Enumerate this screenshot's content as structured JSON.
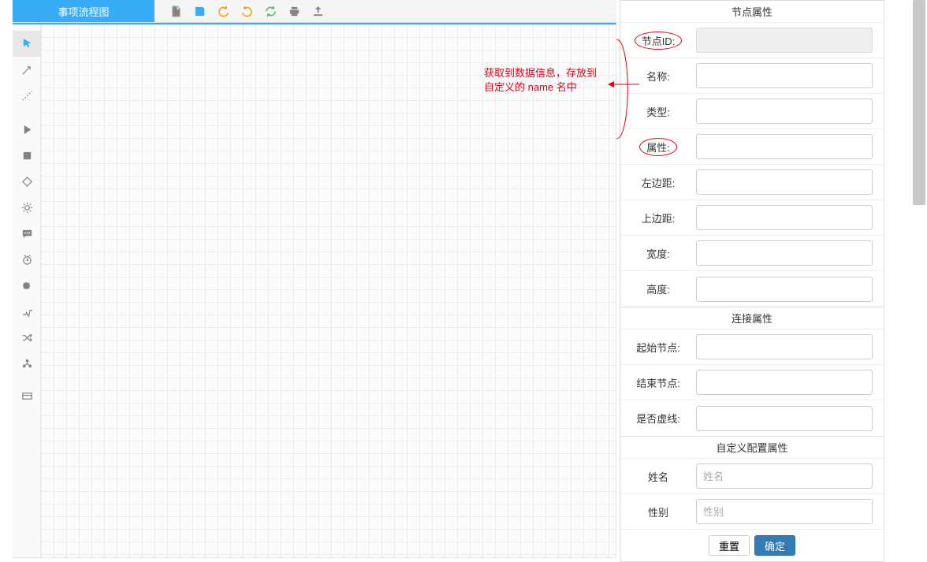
{
  "title": "事项流程图",
  "annotation": {
    "line1": "获取到数据信息，存放到",
    "line2": "自定义的 name 名中"
  },
  "sections": {
    "node": {
      "title": "节点属性",
      "fields": [
        {
          "key": "nodeId",
          "label": "节点ID:",
          "circled": true,
          "readonly": true,
          "value": ""
        },
        {
          "key": "name",
          "label": "名称:",
          "circled": false,
          "readonly": false,
          "value": ""
        },
        {
          "key": "type",
          "label": "类型:",
          "circled": false,
          "readonly": false,
          "value": ""
        },
        {
          "key": "attr",
          "label": "属性:",
          "circled": true,
          "readonly": false,
          "value": ""
        },
        {
          "key": "left",
          "label": "左边距:",
          "circled": false,
          "readonly": false,
          "value": ""
        },
        {
          "key": "top",
          "label": "上边距:",
          "circled": false,
          "readonly": false,
          "value": ""
        },
        {
          "key": "width",
          "label": "宽度:",
          "circled": false,
          "readonly": false,
          "value": ""
        },
        {
          "key": "height",
          "label": "高度:",
          "circled": false,
          "readonly": false,
          "value": ""
        }
      ]
    },
    "conn": {
      "title": "连接属性",
      "fields": [
        {
          "key": "startNode",
          "label": "起始节点:",
          "value": ""
        },
        {
          "key": "endNode",
          "label": "结束节点:",
          "value": ""
        },
        {
          "key": "dashed",
          "label": "是否虚线:",
          "value": ""
        }
      ]
    },
    "custom": {
      "title": "自定义配置属性",
      "fields": [
        {
          "key": "xingming",
          "label": "姓名",
          "placeholder": "姓名",
          "value": ""
        },
        {
          "key": "xingbie",
          "label": "性别",
          "placeholder": "性别",
          "value": ""
        }
      ]
    }
  },
  "buttons": {
    "reset": "重置",
    "ok": "确定"
  }
}
